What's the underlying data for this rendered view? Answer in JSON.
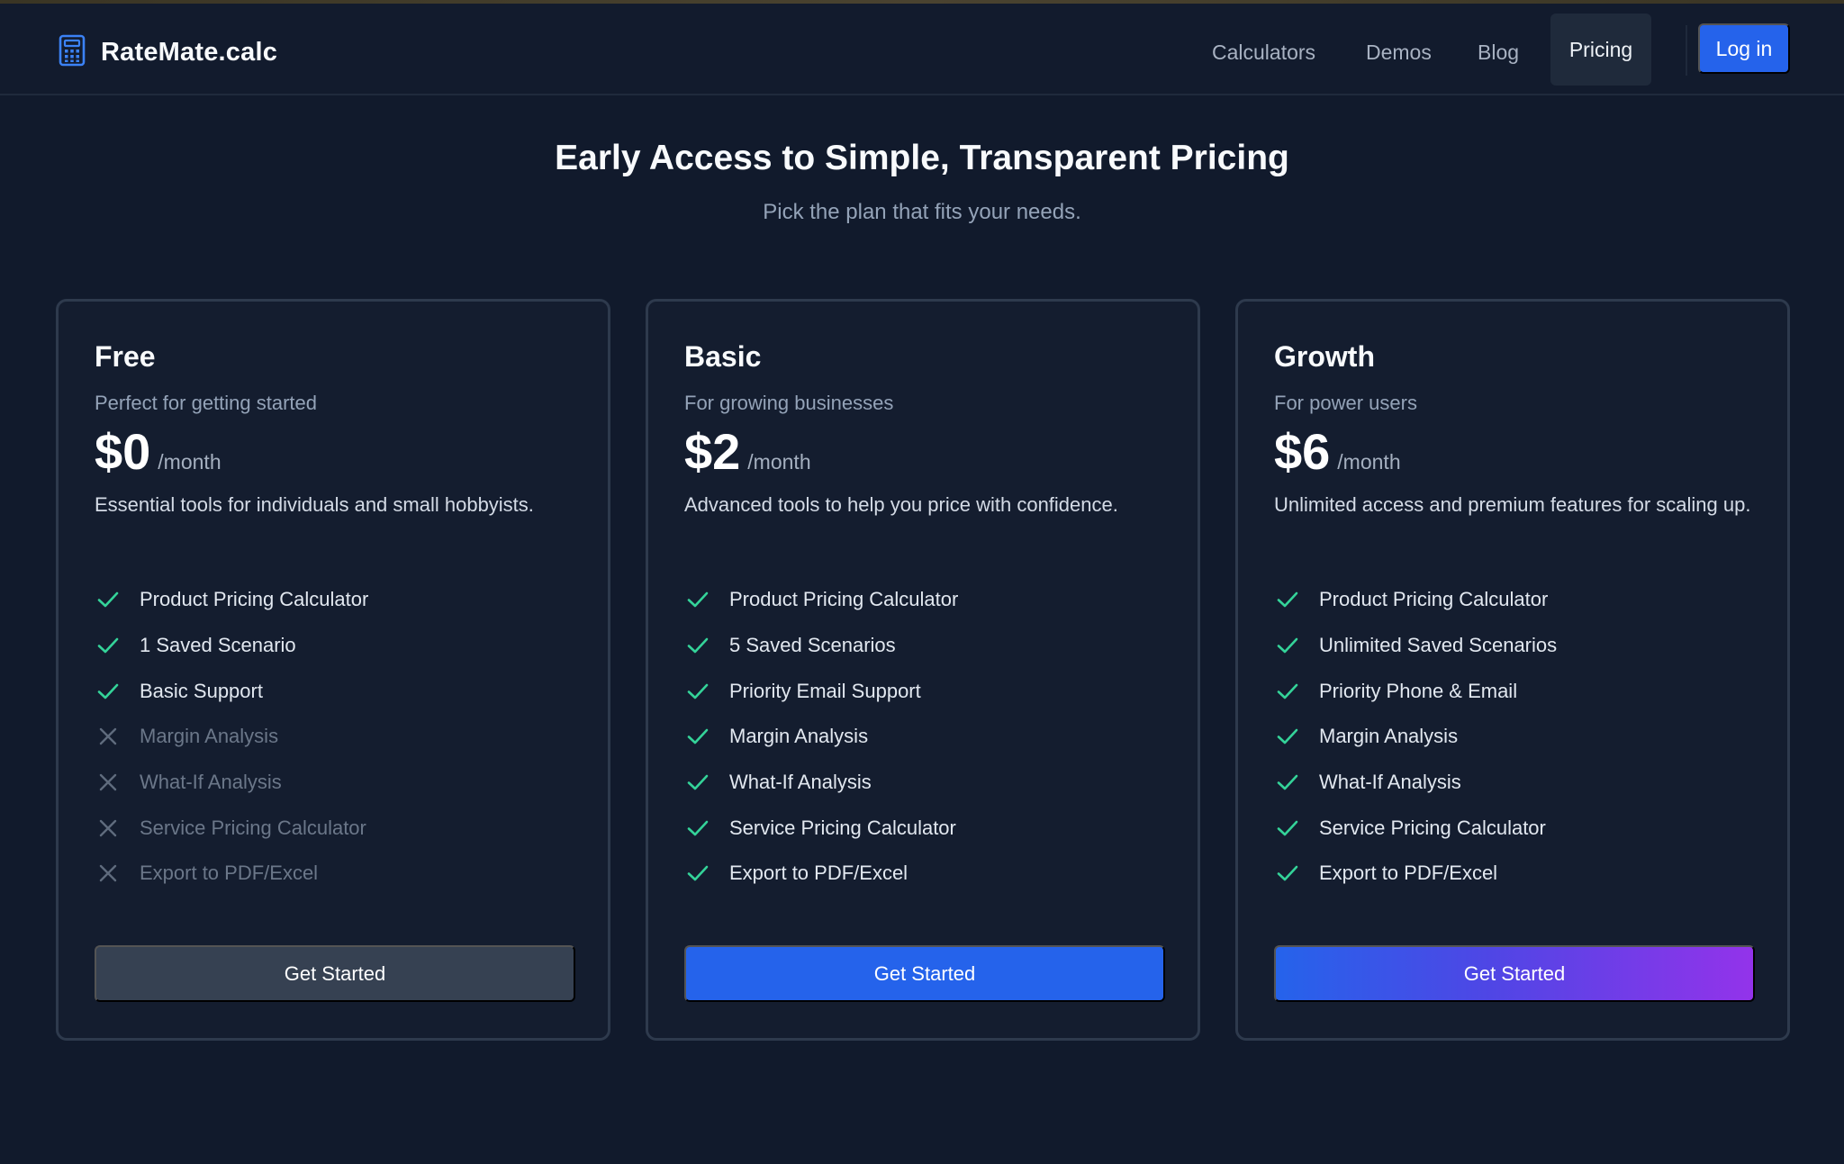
{
  "brand": {
    "name": "RateMate.calc",
    "icon": "calculator-icon"
  },
  "nav": {
    "links": [
      "Calculators",
      "Demos",
      "Blog"
    ],
    "active": "Pricing",
    "login": "Log in"
  },
  "hero": {
    "title": "Early Access to Simple, Transparent Pricing",
    "subtitle": "Pick the plan that fits your needs."
  },
  "colors": {
    "background": "#111a2c",
    "accent": "#2563eb",
    "check": "#34d399",
    "gradient_end": "#9333ea"
  },
  "plans": [
    {
      "name": "Free",
      "tagline": "Perfect for getting started",
      "price": "$0",
      "period": "/month",
      "description": "Essential tools for individuals and small hobbyists.",
      "features": [
        {
          "label": "Product Pricing Calculator",
          "included": true
        },
        {
          "label": "1 Saved Scenario",
          "included": true
        },
        {
          "label": "Basic Support",
          "included": true
        },
        {
          "label": "Margin Analysis",
          "included": false
        },
        {
          "label": "What-If Analysis",
          "included": false
        },
        {
          "label": "Service Pricing Calculator",
          "included": false
        },
        {
          "label": "Export to PDF/Excel",
          "included": false
        }
      ],
      "cta": "Get Started"
    },
    {
      "name": "Basic",
      "tagline": "For growing businesses",
      "price": "$2",
      "period": "/month",
      "description": "Advanced tools to help you price with confidence.",
      "features": [
        {
          "label": "Product Pricing Calculator",
          "included": true
        },
        {
          "label": "5 Saved Scenarios",
          "included": true
        },
        {
          "label": "Priority Email Support",
          "included": true
        },
        {
          "label": "Margin Analysis",
          "included": true
        },
        {
          "label": "What-If Analysis",
          "included": true
        },
        {
          "label": "Service Pricing Calculator",
          "included": true
        },
        {
          "label": "Export to PDF/Excel",
          "included": true
        }
      ],
      "cta": "Get Started"
    },
    {
      "name": "Growth",
      "tagline": "For power users",
      "price": "$6",
      "period": "/month",
      "description": "Unlimited access and premium features for scaling up.",
      "features": [
        {
          "label": "Product Pricing Calculator",
          "included": true
        },
        {
          "label": "Unlimited Saved Scenarios",
          "included": true
        },
        {
          "label": "Priority Phone & Email",
          "included": true
        },
        {
          "label": "Margin Analysis",
          "included": true
        },
        {
          "label": "What-If Analysis",
          "included": true
        },
        {
          "label": "Service Pricing Calculator",
          "included": true
        },
        {
          "label": "Export to PDF/Excel",
          "included": true
        }
      ],
      "cta": "Get Started"
    }
  ]
}
